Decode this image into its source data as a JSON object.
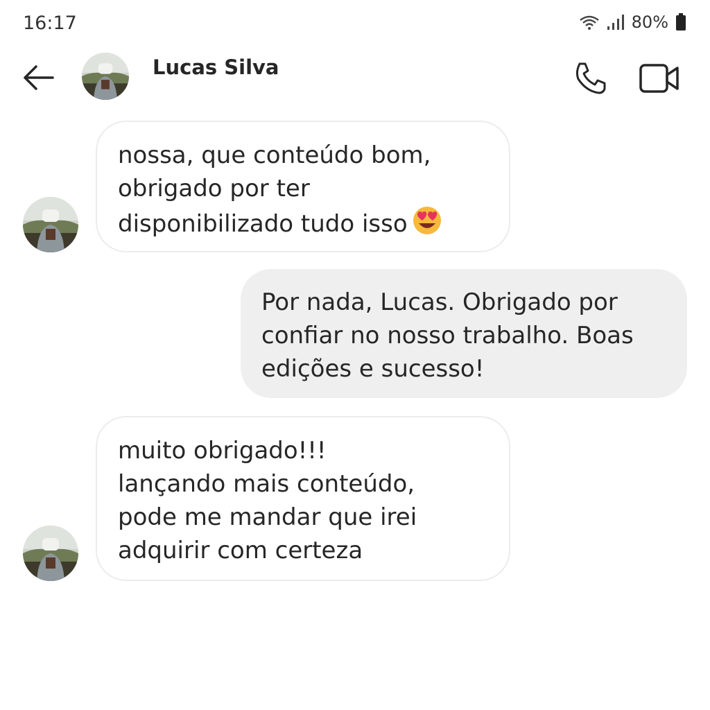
{
  "status_bar": {
    "time": "16:17",
    "battery": "80%"
  },
  "header": {
    "contact_name": "Lucas Silva"
  },
  "icons": {
    "back": "arrow-left-icon",
    "call": "phone-icon",
    "video": "video-camera-icon",
    "wifi": "wifi-icon",
    "signal": "signal-icon",
    "battery": "battery-icon"
  },
  "colors": {
    "incoming_bubble": "#ffffff",
    "outgoing_bubble": "#efefef",
    "text": "#262626"
  },
  "messages": [
    {
      "sender": "Lucas Silva",
      "direction": "incoming",
      "text": "nossa, que conteúdo bom,\nobrigado por ter\ndisponibilizado tudo isso",
      "emoji": "smiling-face-with-heart-eyes"
    },
    {
      "direction": "outgoing",
      "text": "Por nada, Lucas. Obrigado por\nconfiar no nosso trabalho. Boas\nedições e sucesso!"
    },
    {
      "sender": "Lucas Silva",
      "direction": "incoming",
      "text": "muito obrigado!!!\nlançando mais conteúdo,\npode me mandar que irei\nadquirir com certeza"
    }
  ]
}
